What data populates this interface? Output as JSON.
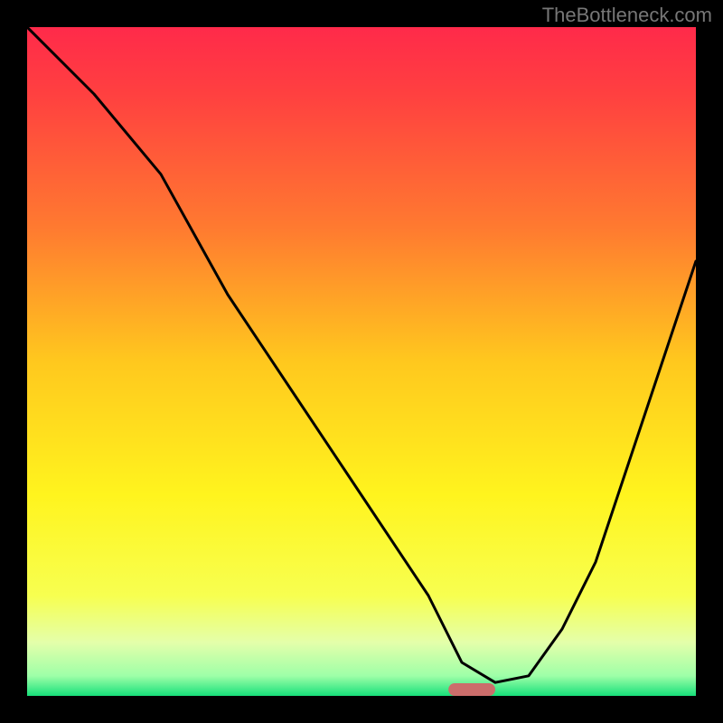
{
  "watermark": "TheBottleneck.com",
  "chart_data": {
    "type": "line",
    "title": "",
    "xlabel": "",
    "ylabel": "",
    "xlim": [
      0,
      100
    ],
    "ylim": [
      0,
      100
    ],
    "series": [
      {
        "name": "curve",
        "x": [
          0,
          10,
          20,
          30,
          40,
          50,
          60,
          65,
          70,
          75,
          80,
          85,
          90,
          95,
          100
        ],
        "y": [
          100,
          90,
          78,
          60,
          45,
          30,
          15,
          5,
          2,
          3,
          10,
          20,
          35,
          50,
          65
        ]
      }
    ],
    "highlight_region": {
      "x_start": 63,
      "x_end": 70,
      "y": 0
    },
    "gradient_stops": [
      {
        "offset": 0.0,
        "color": "#ff2a4a"
      },
      {
        "offset": 0.1,
        "color": "#ff4040"
      },
      {
        "offset": 0.3,
        "color": "#ff7a30"
      },
      {
        "offset": 0.5,
        "color": "#ffc81e"
      },
      {
        "offset": 0.7,
        "color": "#fff41e"
      },
      {
        "offset": 0.85,
        "color": "#f7ff50"
      },
      {
        "offset": 0.92,
        "color": "#e4ffaa"
      },
      {
        "offset": 0.97,
        "color": "#9effa8"
      },
      {
        "offset": 1.0,
        "color": "#17e07a"
      }
    ]
  }
}
